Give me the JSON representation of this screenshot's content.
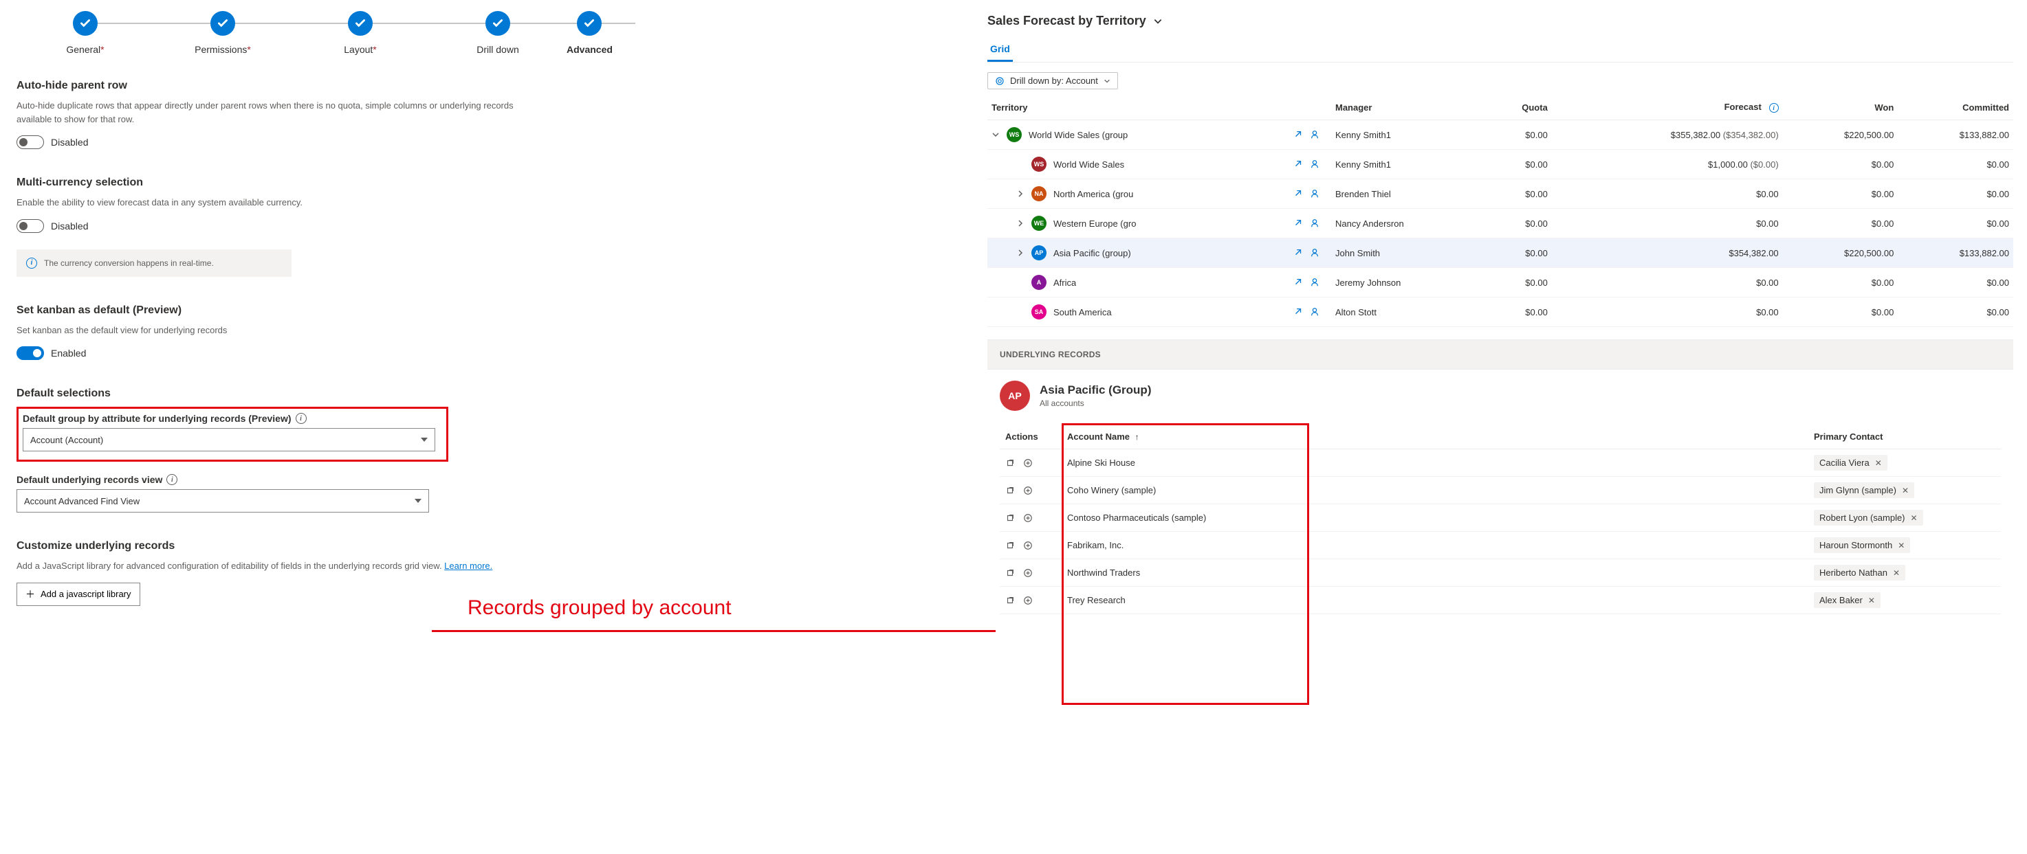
{
  "steps": [
    {
      "label": "General",
      "required": true,
      "filled": true
    },
    {
      "label": "Permissions",
      "required": true,
      "filled": true
    },
    {
      "label": "Layout",
      "required": true,
      "filled": true
    },
    {
      "label": "Drill down",
      "required": false,
      "filled": true
    },
    {
      "label": "Advanced",
      "required": false,
      "filled": true,
      "active": true
    }
  ],
  "sections": {
    "autohide": {
      "title": "Auto-hide parent row",
      "desc": "Auto-hide duplicate rows that appear directly under parent rows when there is no quota, simple columns or underlying records available to show for that row.",
      "state": "Disabled"
    },
    "multicurrency": {
      "title": "Multi-currency selection",
      "desc": "Enable the ability to view forecast data in any system available currency.",
      "state": "Disabled",
      "info": "The currency conversion happens in real-time."
    },
    "kanban": {
      "title": "Set kanban as default (Preview)",
      "desc": "Set kanban as the default view for underlying records",
      "state": "Enabled"
    },
    "defaults": {
      "title": "Default selections",
      "groupByLabel": "Default group by attribute for underlying records (Preview)",
      "groupByValue": "Account (Account)",
      "viewLabel": "Default underlying records view",
      "viewValue": "Account Advanced Find View"
    },
    "customize": {
      "title": "Customize underlying records",
      "desc": "Add a JavaScript library for advanced configuration of editability of fields in the underlying records grid view. ",
      "learnMore": "Learn more.",
      "button": "Add a javascript library"
    }
  },
  "annotation": "Records grouped by account",
  "forecast": {
    "title": "Sales Forecast by Territory",
    "tabs": {
      "grid": "Grid"
    },
    "drilldown": "Drill down by: Account",
    "columns": {
      "territory": "Territory",
      "manager": "Manager",
      "quota": "Quota",
      "forecast": "Forecast",
      "won": "Won",
      "committed": "Committed"
    },
    "rows": [
      {
        "indent": 0,
        "expand": "down",
        "avatar": "WS",
        "color": "#107c10",
        "name": "World Wide Sales (group",
        "manager": "Kenny Smith1",
        "quota": "$0.00",
        "forecast": "$355,382.00",
        "forecast2": "($354,382.00)",
        "won": "$220,500.00",
        "committed": "$133,882.00"
      },
      {
        "indent": 1,
        "expand": null,
        "avatar": "WS",
        "color": "#a4262c",
        "name": "World Wide Sales",
        "manager": "Kenny Smith1",
        "quota": "$0.00",
        "forecast": "$1,000.00",
        "forecast2": "($0.00)",
        "won": "$0.00",
        "committed": "$0.00"
      },
      {
        "indent": 1,
        "expand": "right",
        "avatar": "NA",
        "color": "#ca5010",
        "name": "North America (grou",
        "manager": "Brenden Thiel",
        "quota": "$0.00",
        "forecast": "$0.00",
        "forecast2": "",
        "won": "$0.00",
        "committed": "$0.00"
      },
      {
        "indent": 1,
        "expand": "right",
        "avatar": "WE",
        "color": "#107c10",
        "name": "Western Europe (gro",
        "manager": "Nancy Andersron",
        "quota": "$0.00",
        "forecast": "$0.00",
        "forecast2": "",
        "won": "$0.00",
        "committed": "$0.00"
      },
      {
        "indent": 1,
        "expand": "right",
        "avatar": "AP",
        "color": "#0078d4",
        "name": "Asia Pacific (group)",
        "manager": "John Smith",
        "quota": "$0.00",
        "forecast": "$354,382.00",
        "forecast2": "",
        "won": "$220,500.00",
        "committed": "$133,882.00",
        "highlight": true
      },
      {
        "indent": 1,
        "expand": null,
        "avatar": "A",
        "color": "#881798",
        "name": "Africa",
        "manager": "Jeremy Johnson",
        "quota": "$0.00",
        "forecast": "$0.00",
        "forecast2": "",
        "won": "$0.00",
        "committed": "$0.00"
      },
      {
        "indent": 1,
        "expand": null,
        "avatar": "SA",
        "color": "#e3008c",
        "name": "South America",
        "manager": "Alton Stott",
        "quota": "$0.00",
        "forecast": "$0.00",
        "forecast2": "",
        "won": "$0.00",
        "committed": "$0.00"
      }
    ]
  },
  "underlying": {
    "header": "UNDERLYING RECORDS",
    "groupAvatar": "AP",
    "groupColor": "#d13438",
    "groupTitle": "Asia Pacific (Group)",
    "groupSub": "All accounts",
    "columns": {
      "actions": "Actions",
      "accountName": "Account Name",
      "primaryContact": "Primary Contact"
    },
    "rows": [
      {
        "name": "Alpine Ski House",
        "contact": "Cacilia Viera"
      },
      {
        "name": "Coho Winery (sample)",
        "contact": "Jim Glynn (sample)"
      },
      {
        "name": "Contoso Pharmaceuticals (sample)",
        "contact": "Robert Lyon (sample)"
      },
      {
        "name": "Fabrikam, Inc.",
        "contact": "Haroun Stormonth"
      },
      {
        "name": "Northwind Traders",
        "contact": "Heriberto Nathan"
      },
      {
        "name": "Trey Research",
        "contact": "Alex Baker"
      }
    ]
  }
}
